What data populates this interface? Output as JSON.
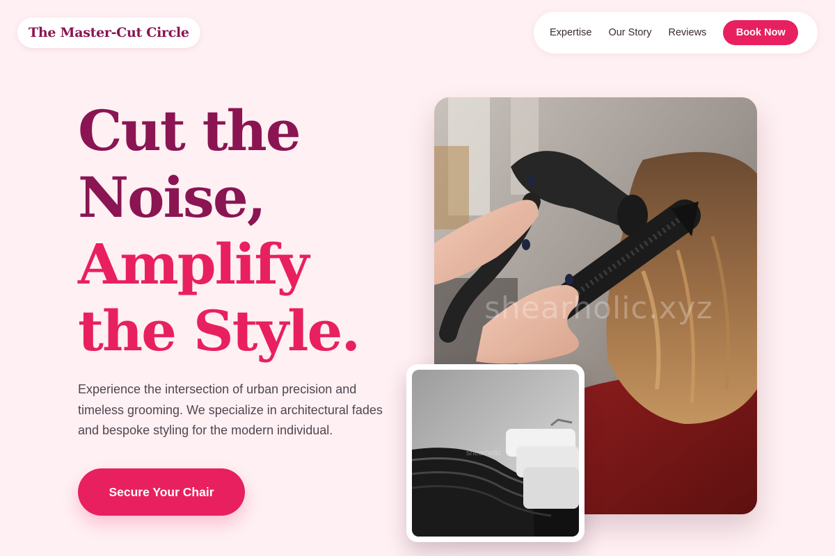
{
  "brand": {
    "name": "The Master-Cut Circle"
  },
  "nav": {
    "items": [
      "Expertise",
      "Our Story",
      "Reviews"
    ],
    "book_label": "Book Now"
  },
  "hero": {
    "line1": "Cut the",
    "line2": "Noise,",
    "line3": "Amplify",
    "line4": "the Style.",
    "description": "Experience the intersection of urban precision and timeless grooming. We specialize in architectural fades and bespoke styling for the modern individual.",
    "cta_label": "Secure Your Chair"
  },
  "images": {
    "main_watermark": "shearholic.xyz",
    "small_watermark": "shearholic"
  },
  "colors": {
    "background": "#fff0f3",
    "brand_dark": "#8a1552",
    "accent": "#e8205f",
    "text": "#4f4650"
  }
}
